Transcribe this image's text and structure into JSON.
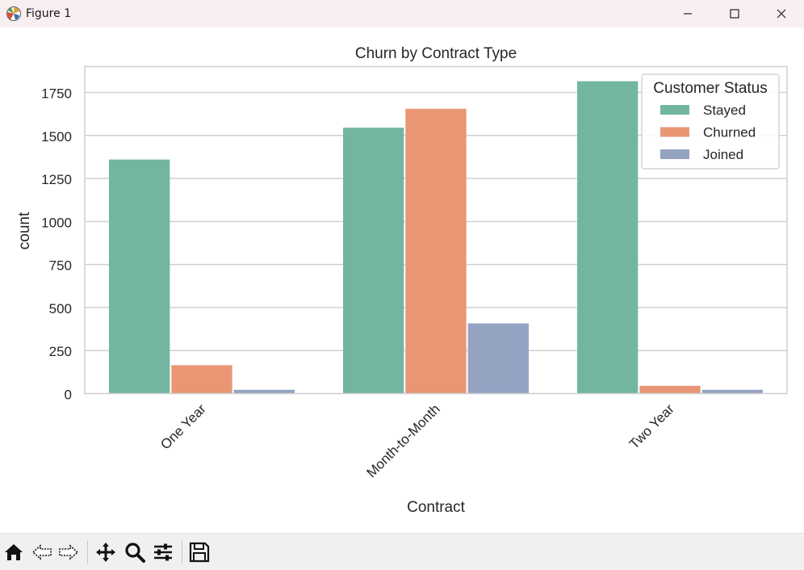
{
  "window": {
    "title": "Figure 1",
    "icons": [
      "app-icon",
      "minimize-icon",
      "maximize-icon",
      "close-icon"
    ]
  },
  "toolbar": {
    "icons": [
      "home-icon",
      "back-icon",
      "forward-icon",
      "pan-icon",
      "zoom-icon",
      "configure-icon",
      "save-icon"
    ]
  },
  "colors": {
    "stayed": "#72b6a1",
    "churned": "#e99675",
    "joined": "#95a3c3",
    "grid": "#d0d0d0",
    "frame": "#cfcfcf",
    "text": "#262626"
  },
  "chart_data": {
    "type": "bar",
    "title": "Churn by Contract Type",
    "xlabel": "Contract",
    "ylabel": "count",
    "categories": [
      "One Year",
      "Month-to-Month",
      "Two Year"
    ],
    "series": [
      {
        "name": "Stayed",
        "values": [
          1360,
          1545,
          1815
        ]
      },
      {
        "name": "Churned",
        "values": [
          165,
          1655,
          45
        ]
      },
      {
        "name": "Joined",
        "values": [
          22,
          408,
          22
        ]
      }
    ],
    "ylim": [
      0,
      1900
    ],
    "yticks": [
      0,
      250,
      500,
      750,
      1000,
      1250,
      1500,
      1750
    ],
    "grid": true,
    "legend": {
      "title": "Customer Status",
      "placement": "upper-right"
    },
    "xtick_rotation": 45
  }
}
